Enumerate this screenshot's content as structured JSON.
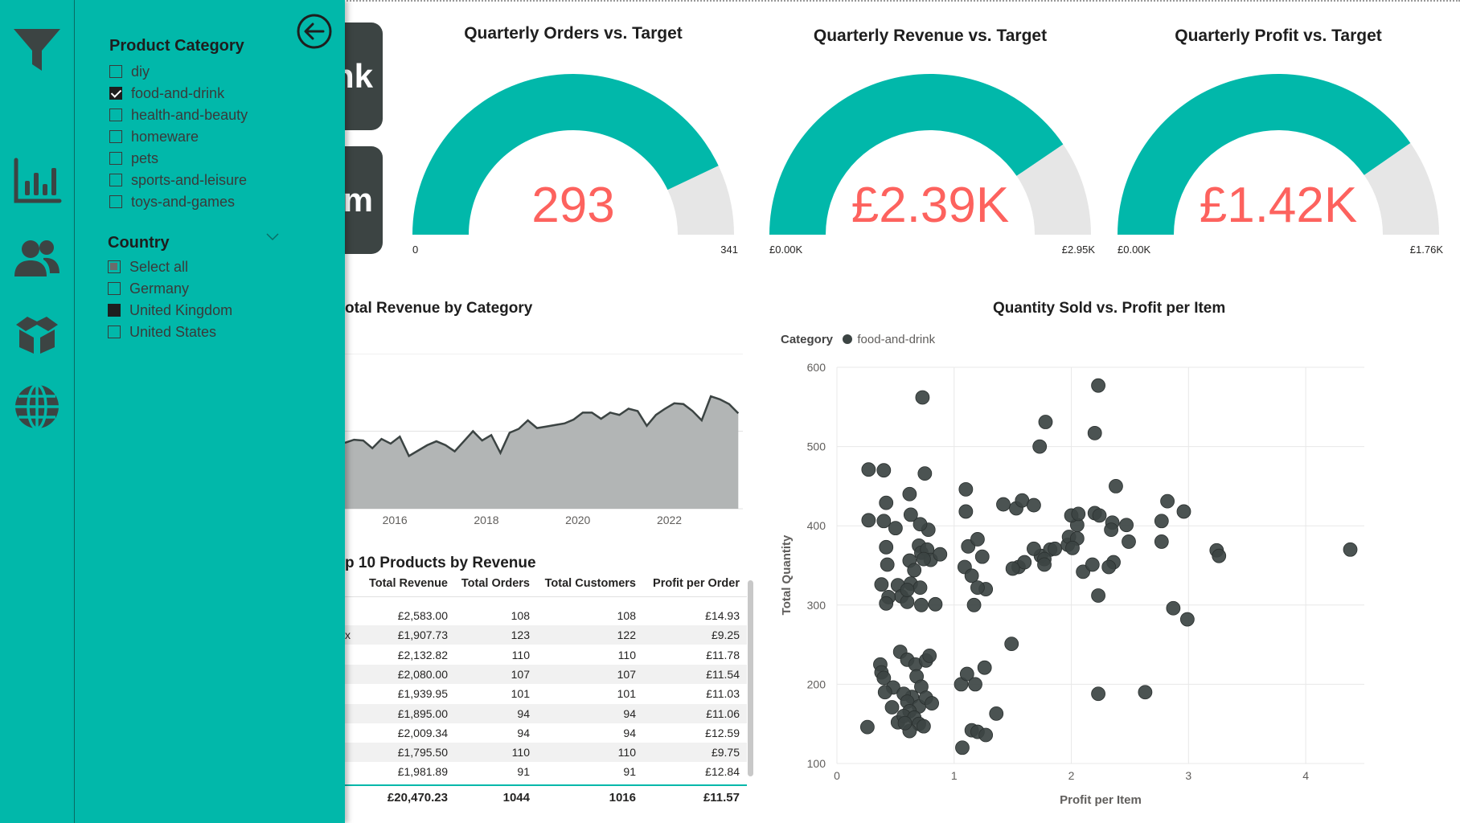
{
  "nav_buttons": [
    "nk",
    "m"
  ],
  "rail_icons": [
    "funnel-icon",
    "bar-chart-icon",
    "users-icon",
    "box-icon",
    "globe-icon"
  ],
  "filters": {
    "product_category": {
      "title": "Product Category",
      "options": [
        {
          "label": "diy",
          "state": "unchecked"
        },
        {
          "label": "food-and-drink",
          "state": "checked"
        },
        {
          "label": "health-and-beauty",
          "state": "unchecked"
        },
        {
          "label": "homeware",
          "state": "unchecked"
        },
        {
          "label": "pets",
          "state": "unchecked"
        },
        {
          "label": "sports-and-leisure",
          "state": "unchecked"
        },
        {
          "label": "toys-and-games",
          "state": "unchecked"
        }
      ]
    },
    "country": {
      "title": "Country",
      "options": [
        {
          "label": "Select all",
          "state": "partial"
        },
        {
          "label": "Germany",
          "state": "unchecked"
        },
        {
          "label": "United Kingdom",
          "state": "filled"
        },
        {
          "label": "United States",
          "state": "unchecked"
        }
      ]
    }
  },
  "gauges": [
    {
      "title": "Quarterly Orders vs. Target",
      "value": "293",
      "min": "0",
      "max": "341",
      "fraction": 0.859
    },
    {
      "title": "Quarterly Revenue vs. Target",
      "value": "£2.39K",
      "min": "£0.00K",
      "max": "£2.95K",
      "fraction": 0.81
    },
    {
      "title": "Quarterly Profit vs. Target",
      "value": "£1.42K",
      "min": "£0.00K",
      "max": "£1.76K",
      "fraction": 0.807
    }
  ],
  "colors": {
    "teal": "#01b8aa",
    "dark": "#3c4443",
    "gauge_bg": "#e6e6e6",
    "value_red": "#fd625e"
  },
  "area_chart": {
    "title": "otal Revenue by Category",
    "x_ticks": [
      "2016",
      "2018",
      "2020",
      "2022"
    ]
  },
  "table": {
    "title": "p 10 Products by Revenue",
    "columns": [
      "Total Revenue",
      "Total Orders",
      "Total Customers",
      "Profit per Order"
    ],
    "rows": [
      [
        "£2,583.00",
        "108",
        "108",
        "£14.93"
      ],
      [
        "£1,907.73",
        "123",
        "122",
        "£9.25"
      ],
      [
        "£2,132.82",
        "110",
        "110",
        "£11.78"
      ],
      [
        "£2,080.00",
        "107",
        "107",
        "£11.54"
      ],
      [
        "£1,939.95",
        "101",
        "101",
        "£11.03"
      ],
      [
        "£1,895.00",
        "94",
        "94",
        "£11.06"
      ],
      [
        "£2,009.34",
        "94",
        "94",
        "£12.59"
      ],
      [
        "£1,795.50",
        "110",
        "110",
        "£9.75"
      ],
      [
        "£1,981.89",
        "91",
        "91",
        "£12.84"
      ]
    ],
    "row_fragment": "x",
    "totals": [
      "£20,470.23",
      "1044",
      "1016",
      "£11.57"
    ]
  },
  "chart_data": [
    {
      "type": "area",
      "title": "otal Revenue by Category",
      "x": [
        2014.9,
        2015.1,
        2015.3,
        2015.5,
        2015.7,
        2015.9,
        2016.1,
        2016.3,
        2016.5,
        2016.7,
        2016.9,
        2017.1,
        2017.3,
        2017.5,
        2017.7,
        2017.9,
        2018.1,
        2018.3,
        2018.5,
        2018.7,
        2018.9,
        2019.1,
        2019.3,
        2019.5,
        2019.7,
        2019.9,
        2020.1,
        2020.3,
        2020.5,
        2020.7,
        2020.9,
        2021.1,
        2021.3,
        2021.5,
        2021.7,
        2021.9,
        2022.1,
        2022.3,
        2022.5,
        2022.7,
        2022.9,
        2023.1,
        2023.3,
        2023.5
      ],
      "y": [
        0.85,
        0.89,
        0.88,
        0.78,
        0.9,
        0.84,
        0.93,
        0.68,
        0.75,
        0.82,
        0.87,
        0.82,
        0.74,
        0.87,
        1.0,
        0.88,
        0.95,
        0.72,
        0.98,
        1.03,
        1.14,
        1.04,
        1.06,
        1.08,
        1.1,
        1.15,
        1.24,
        1.24,
        1.16,
        1.24,
        1.21,
        1.29,
        1.26,
        1.07,
        1.21,
        1.29,
        1.36,
        1.35,
        1.26,
        1.14,
        1.45,
        1.41,
        1.35,
        1.23
      ],
      "xlim": [
        2014.9,
        2023.6
      ],
      "ylim": [
        0,
        2.0
      ],
      "x_ticks": [
        "2016",
        "2018",
        "2020",
        "2022"
      ],
      "grid": true,
      "color": "#b2b5b5"
    },
    {
      "type": "scatter",
      "title": "Quantity Sold vs. Profit per Item",
      "xlabel": "Profit per Item",
      "ylabel": "Total Quantity",
      "legend_title": "Category",
      "series": [
        {
          "name": "food-and-drink"
        }
      ],
      "xlim": [
        0,
        4.5
      ],
      "ylim": [
        100,
        600
      ],
      "x_ticks": [
        "0",
        "1",
        "2",
        "3",
        "4"
      ],
      "y_ticks": [
        "100",
        "200",
        "300",
        "400",
        "500",
        "600"
      ],
      "points": [
        [
          0.73,
          562
        ],
        [
          2.23,
          577
        ],
        [
          1.78,
          531
        ],
        [
          2.2,
          517
        ],
        [
          1.73,
          500
        ],
        [
          0.27,
          471
        ],
        [
          0.4,
          470
        ],
        [
          0.75,
          466
        ],
        [
          0.27,
          407
        ],
        [
          0.4,
          406
        ],
        [
          0.42,
          429
        ],
        [
          0.62,
          440
        ],
        [
          0.5,
          397
        ],
        [
          0.78,
          395
        ],
        [
          0.71,
          402
        ],
        [
          0.42,
          373
        ],
        [
          0.63,
          414
        ],
        [
          0.7,
          375
        ],
        [
          0.72,
          366
        ],
        [
          0.77,
          370
        ],
        [
          0.43,
          351
        ],
        [
          0.8,
          357
        ],
        [
          0.88,
          364
        ],
        [
          0.62,
          356
        ],
        [
          0.66,
          344
        ],
        [
          0.74,
          358
        ],
        [
          0.52,
          325
        ],
        [
          0.38,
          326
        ],
        [
          0.63,
          327
        ],
        [
          0.55,
          311
        ],
        [
          0.6,
          304
        ],
        [
          0.71,
          322
        ],
        [
          0.44,
          310
        ],
        [
          0.6,
          319
        ],
        [
          0.72,
          300
        ],
        [
          0.84,
          301
        ],
        [
          0.42,
          302
        ],
        [
          1.1,
          446
        ],
        [
          1.1,
          418
        ],
        [
          1.12,
          374
        ],
        [
          1.2,
          383
        ],
        [
          1.24,
          361
        ],
        [
          1.09,
          348
        ],
        [
          1.15,
          337
        ],
        [
          1.27,
          320
        ],
        [
          1.2,
          322
        ],
        [
          1.17,
          300
        ],
        [
          1.42,
          427
        ],
        [
          1.53,
          422
        ],
        [
          1.58,
          432
        ],
        [
          1.68,
          426
        ],
        [
          1.55,
          348
        ],
        [
          1.6,
          354
        ],
        [
          1.5,
          346
        ],
        [
          1.74,
          362
        ],
        [
          1.68,
          371
        ],
        [
          1.82,
          370
        ],
        [
          1.77,
          358
        ],
        [
          1.77,
          351
        ],
        [
          1.86,
          371
        ],
        [
          1.97,
          376
        ],
        [
          1.98,
          386
        ],
        [
          2.05,
          401
        ],
        [
          2.0,
          413
        ],
        [
          2.06,
          415
        ],
        [
          2.2,
          416
        ],
        [
          2.24,
          413
        ],
        [
          2.05,
          384
        ],
        [
          2.01,
          372
        ],
        [
          2.1,
          342
        ],
        [
          2.18,
          351
        ],
        [
          2.38,
          450
        ],
        [
          2.35,
          404
        ],
        [
          2.34,
          395
        ],
        [
          2.47,
          401
        ],
        [
          2.49,
          380
        ],
        [
          2.36,
          354
        ],
        [
          2.32,
          348
        ],
        [
          2.23,
          312
        ],
        [
          2.82,
          431
        ],
        [
          2.77,
          406
        ],
        [
          2.96,
          418
        ],
        [
          2.77,
          380
        ],
        [
          2.87,
          296
        ],
        [
          2.99,
          282
        ],
        [
          3.24,
          369
        ],
        [
          3.26,
          362
        ],
        [
          4.38,
          370
        ],
        [
          1.49,
          251
        ],
        [
          2.63,
          190
        ],
        [
          2.23,
          188
        ],
        [
          0.26,
          146
        ],
        [
          0.37,
          225
        ],
        [
          0.38,
          215
        ],
        [
          0.4,
          208
        ],
        [
          0.48,
          196
        ],
        [
          0.54,
          241
        ],
        [
          0.6,
          231
        ],
        [
          0.67,
          225
        ],
        [
          0.76,
          230
        ],
        [
          0.79,
          236
        ],
        [
          0.68,
          210
        ],
        [
          0.72,
          197
        ],
        [
          0.64,
          184
        ],
        [
          0.57,
          188
        ],
        [
          0.6,
          178
        ],
        [
          0.7,
          172
        ],
        [
          0.62,
          166
        ],
        [
          0.52,
          152
        ],
        [
          0.57,
          160
        ],
        [
          0.47,
          171
        ],
        [
          0.41,
          190
        ],
        [
          0.66,
          158
        ],
        [
          0.7,
          150
        ],
        [
          0.76,
          183
        ],
        [
          0.81,
          176
        ],
        [
          0.62,
          141
        ],
        [
          0.74,
          147
        ],
        [
          0.58,
          151
        ],
        [
          1.06,
          200
        ],
        [
          1.11,
          213
        ],
        [
          1.18,
          200
        ],
        [
          1.26,
          221
        ],
        [
          1.15,
          142
        ],
        [
          1.2,
          140
        ],
        [
          1.27,
          136
        ],
        [
          1.36,
          163
        ],
        [
          1.07,
          120
        ]
      ]
    }
  ],
  "scatter_title": "Quantity Sold vs. Profit per Item",
  "scatter_legend_title": "Category",
  "scatter_series_name": "food-and-drink",
  "scatter_xlabel": "Profit per Item",
  "scatter_ylabel": "Total Quantity",
  "scatter_x_ticks": [
    "0",
    "1",
    "2",
    "3",
    "4"
  ],
  "scatter_y_ticks": [
    "100",
    "200",
    "300",
    "400",
    "500",
    "600"
  ]
}
